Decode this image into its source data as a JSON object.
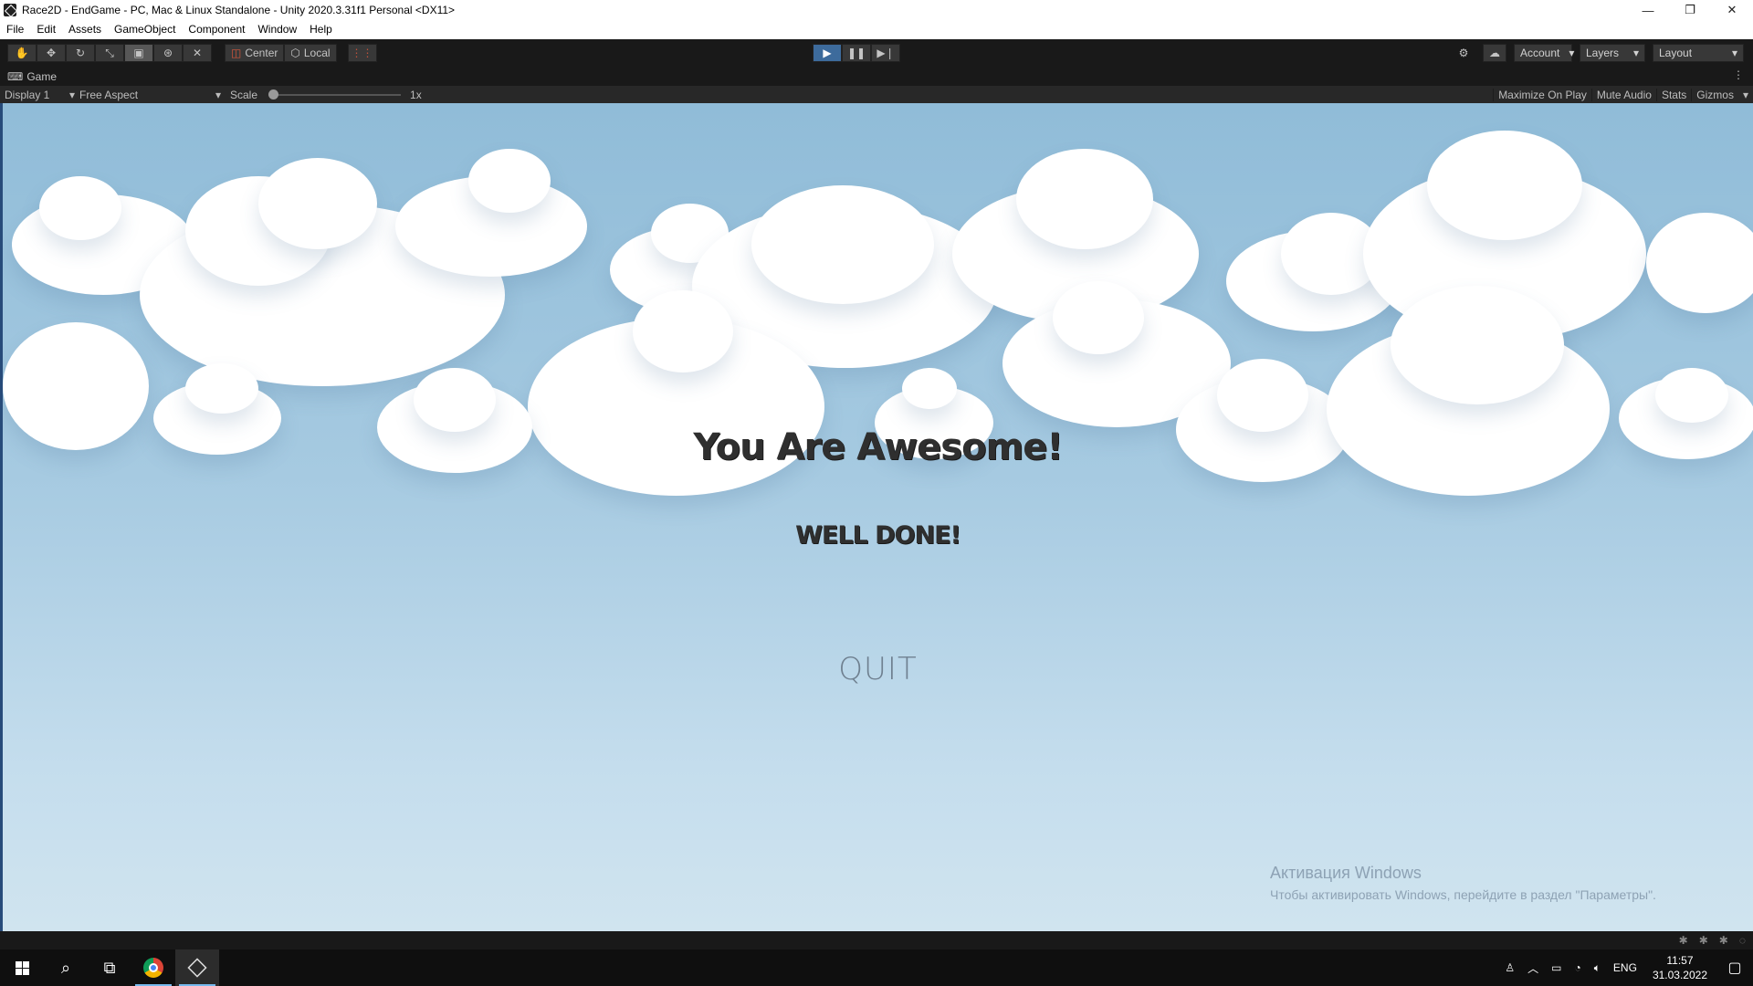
{
  "window": {
    "title": "Race2D - EndGame - PC, Mac & Linux Standalone - Unity 2020.3.31f1 Personal <DX11>",
    "minimize": "—",
    "maximize": "❐",
    "close": "✕"
  },
  "menu": [
    "File",
    "Edit",
    "Assets",
    "GameObject",
    "Component",
    "Window",
    "Help"
  ],
  "toolbar": {
    "tools": [
      "hand-icon",
      "move-icon",
      "rotate-icon",
      "scale-icon",
      "rect-icon",
      "transform-icon",
      "custom-tool-icon"
    ],
    "active_tool": "rect-icon",
    "pivot_label": "Center",
    "space_label": "Local",
    "account_label": "Account",
    "layers_label": "Layers",
    "layout_label": "Layout"
  },
  "playmode": {
    "state": "playing"
  },
  "game_tab": {
    "label": "Game",
    "display": "Display 1",
    "aspect": "Free Aspect",
    "scale_label": "Scale",
    "scale_value": "1x",
    "scale_fraction": 0,
    "maximize_on_play": "Maximize On Play",
    "mute_audio": "Mute Audio",
    "stats": "Stats",
    "gizmos": "Gizmos"
  },
  "game": {
    "headline": "You Are Awesome!",
    "subheadline": "WELL DONE!",
    "quit_label": "QUIT"
  },
  "watermark": {
    "line1": "Активация Windows",
    "line2": "Чтобы активировать Windows, перейдите в раздел \"Параметры\"."
  },
  "taskbar": {
    "lang": "ENG",
    "time": "11:57",
    "date": "31.03.2022"
  },
  "colors": {
    "sky_top": "#90bcd8",
    "sky_bottom": "#d0e4ef",
    "editor_dark": "#191919",
    "play_active": "#3d6b9c"
  }
}
